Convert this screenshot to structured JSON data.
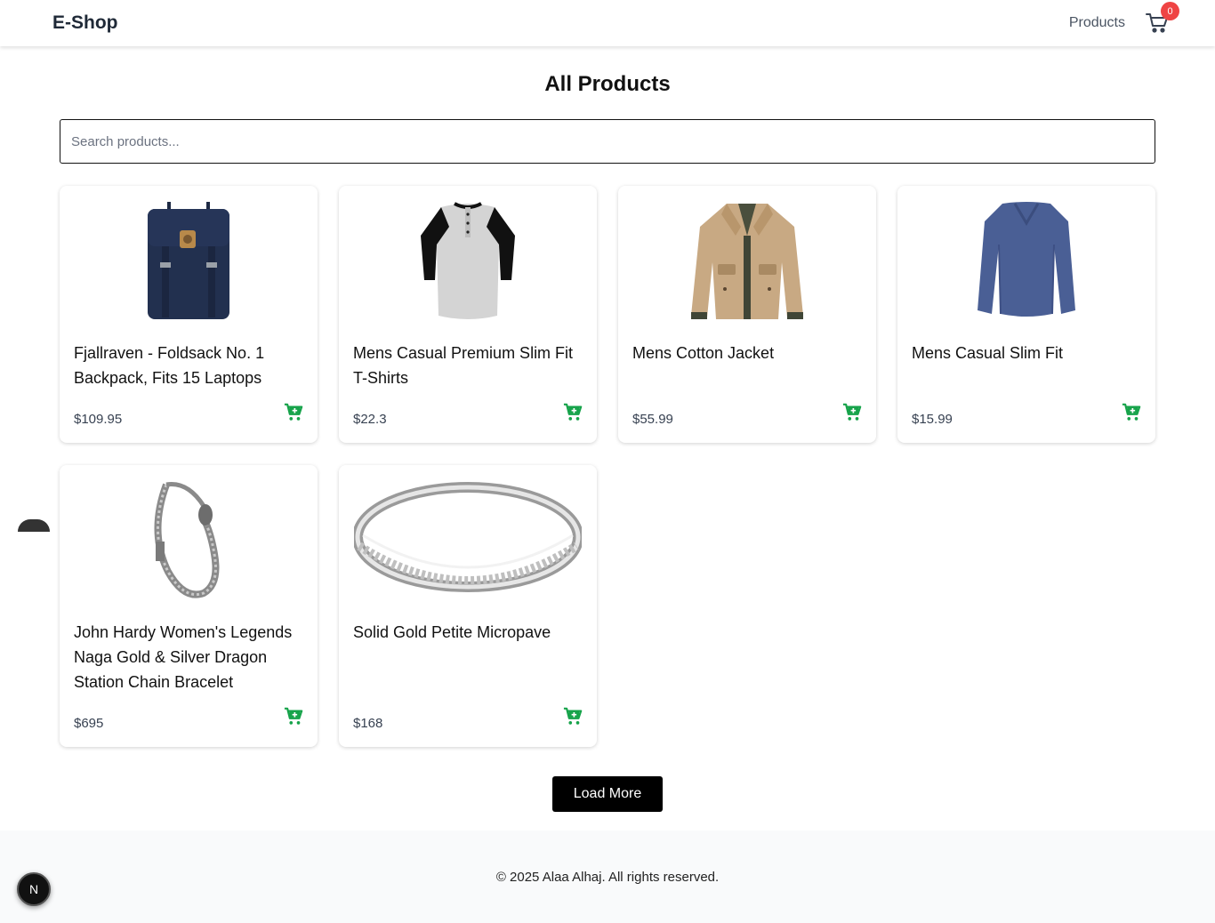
{
  "navbar": {
    "brand": "E-Shop",
    "products_link": "Products",
    "cart_count": "0"
  },
  "page": {
    "title": "All Products"
  },
  "search": {
    "placeholder": "Search products..."
  },
  "products": [
    {
      "title": "Fjallraven - Foldsack No. 1 Backpack, Fits 15 Laptops",
      "price": "$109.95",
      "image": "backpack"
    },
    {
      "title": "Mens Casual Premium Slim Fit T-Shirts",
      "price": "$22.3",
      "image": "raglan-tshirt"
    },
    {
      "title": "Mens Cotton Jacket",
      "price": "$55.99",
      "image": "cotton-jacket"
    },
    {
      "title": "Mens Casual Slim Fit",
      "price": "$15.99",
      "image": "long-sleeve-shirt"
    },
    {
      "title": "John Hardy Women's Legends Naga Gold & Silver Dragon Station Chain Bracelet",
      "price": "$695",
      "image": "chain-bracelet"
    },
    {
      "title": "Solid Gold Petite Micropave",
      "price": "$168",
      "image": "silver-ring"
    }
  ],
  "actions": {
    "load_more": "Load More"
  },
  "footer": {
    "text": "© 2025 Alaa Alhaj. All rights reserved."
  },
  "dev_badge": {
    "letter": "N"
  },
  "colors": {
    "cart_green": "#16a34a",
    "badge_red": "#ef4444",
    "button_black": "#000000"
  }
}
